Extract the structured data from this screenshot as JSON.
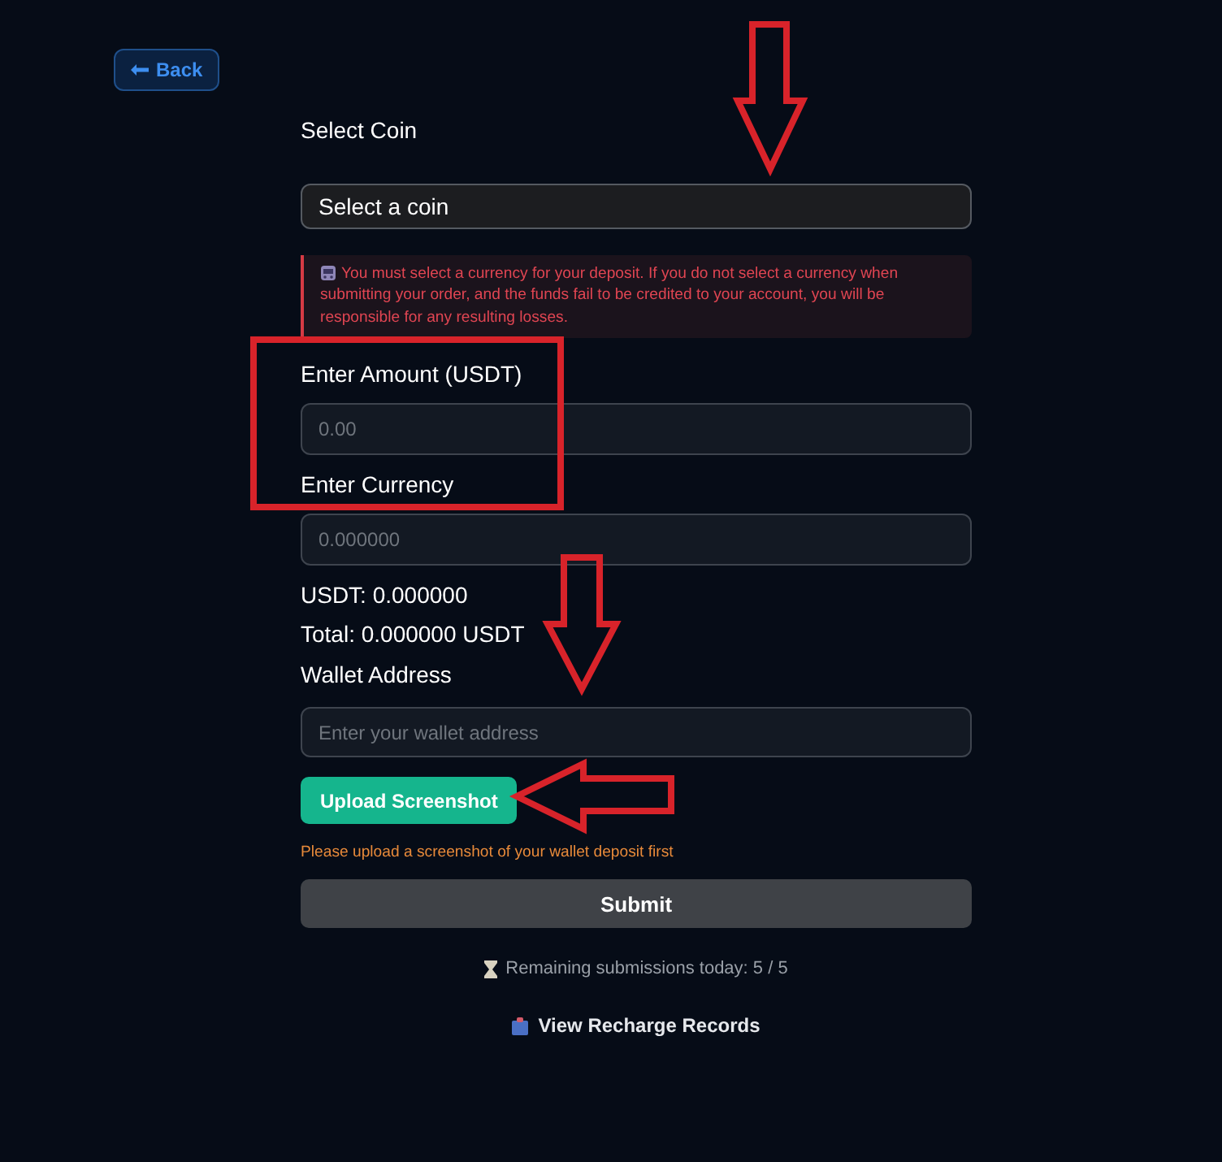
{
  "back_button": {
    "label": "Back"
  },
  "coin": {
    "label": "Select Coin",
    "value": "Select a coin"
  },
  "warning": "You must select a currency for your deposit. If you do not select a currency when submitting your order, and the funds fail to be credited to your account, you will be responsible for any resulting losses.",
  "amount": {
    "label": "Enter Amount (USDT)",
    "placeholder": "0.00"
  },
  "currency": {
    "label": "Enter Currency",
    "placeholder": "0.000000"
  },
  "usdt_line": "USDT: 0.000000",
  "total_line": "Total: 0.000000 USDT",
  "wallet": {
    "label": "Wallet Address",
    "placeholder": "Enter your wallet address"
  },
  "upload_button": {
    "label": "Upload Screenshot"
  },
  "upload_hint": "Please upload a screenshot of your wallet deposit first",
  "submit_button": {
    "label": "Submit"
  },
  "remaining": "Remaining submissions today: 5 / 5",
  "records_link": "View Recharge Records"
}
